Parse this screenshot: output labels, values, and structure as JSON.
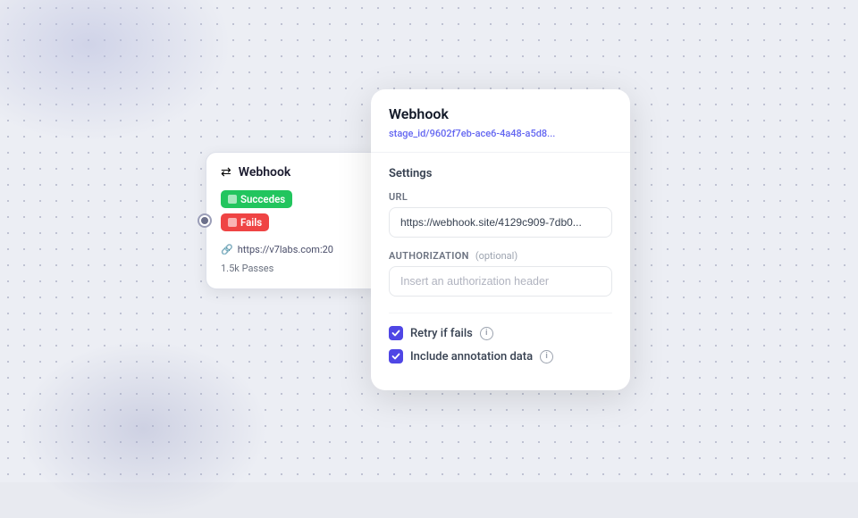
{
  "background": {
    "dot_color": "#b0b4c8"
  },
  "webhook_card": {
    "title": "Webhook",
    "badge_success": "Succedes",
    "badge_fail": "Fails",
    "url_preview": "https://v7labs.com:20",
    "passes": "1.5k Passes"
  },
  "settings_panel": {
    "title": "Webhook",
    "breadcrumb_prefix": "stage_id/",
    "breadcrumb_value": "9602f7eb-ace6-4a48-a5d8...",
    "section_label": "Settings",
    "url_label": "URL",
    "url_value": "https://webhook.site/4129c909-7db0...",
    "auth_label": "Authorization",
    "auth_optional": "(optional)",
    "auth_placeholder": "Insert an authorization header",
    "retry_label": "Retry if fails",
    "annotation_label": "Include annotation data"
  }
}
